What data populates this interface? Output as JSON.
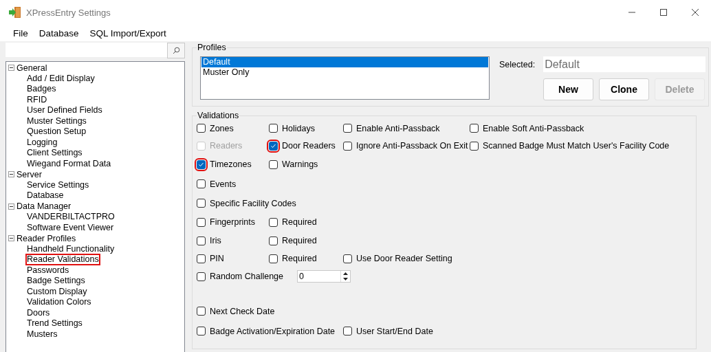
{
  "window": {
    "title": "XPressEntry Settings"
  },
  "menu": [
    "File",
    "Database",
    "SQL Import/Export"
  ],
  "tree": [
    {
      "label": "General",
      "expanded": true,
      "children": [
        {
          "label": "Add / Edit Display",
          "highlighted": false
        },
        {
          "label": "Badges",
          "highlighted": false
        },
        {
          "label": "RFID",
          "highlighted": false
        },
        {
          "label": "User Defined Fields",
          "highlighted": false
        },
        {
          "label": "Muster Settings",
          "highlighted": false
        },
        {
          "label": "Question Setup",
          "highlighted": false
        },
        {
          "label": "Logging",
          "highlighted": false
        },
        {
          "label": "Client Settings",
          "highlighted": false
        },
        {
          "label": "Wiegand Format Data",
          "highlighted": false
        }
      ]
    },
    {
      "label": "Server",
      "expanded": true,
      "children": [
        {
          "label": "Service Settings",
          "highlighted": false
        },
        {
          "label": "Database",
          "highlighted": false
        }
      ]
    },
    {
      "label": "Data Manager",
      "expanded": true,
      "children": [
        {
          "label": "VANDERBILTACTPRO",
          "highlighted": false
        },
        {
          "label": "Software Event Viewer",
          "highlighted": false
        }
      ]
    },
    {
      "label": "Reader Profiles",
      "expanded": true,
      "children": [
        {
          "label": "Handheld Functionality",
          "highlighted": false
        },
        {
          "label": "Reader Validations",
          "highlighted": true
        },
        {
          "label": "Passwords",
          "highlighted": false
        },
        {
          "label": "Badge Settings",
          "highlighted": false
        },
        {
          "label": "Custom Display",
          "highlighted": false
        },
        {
          "label": "Validation Colors",
          "highlighted": false
        },
        {
          "label": "Doors",
          "highlighted": false
        },
        {
          "label": "Trend Settings",
          "highlighted": false
        },
        {
          "label": "Musters",
          "highlighted": false
        }
      ]
    }
  ],
  "profiles": {
    "title": "Profiles",
    "items": [
      {
        "label": "Default",
        "selected": true
      },
      {
        "label": "Muster Only",
        "selected": false
      }
    ],
    "selected_label": "Selected:",
    "selected_value": "Default",
    "buttons": [
      {
        "label": "New",
        "disabled": false
      },
      {
        "label": "Clone",
        "disabled": false
      },
      {
        "label": "Delete",
        "disabled": true
      }
    ]
  },
  "validations": {
    "title": "Validations",
    "rows": [
      [
        {
          "kind": "checkbox",
          "label": "Zones",
          "checked": false,
          "disabled": false,
          "highlighted": false
        },
        {
          "kind": "checkbox",
          "label": "Holidays",
          "checked": false,
          "disabled": false,
          "highlighted": false
        },
        {
          "kind": "checkbox",
          "label": "Enable Anti-Passback",
          "checked": false,
          "disabled": false,
          "highlighted": false
        },
        {
          "kind": "checkbox",
          "label": "Enable Soft Anti-Passback",
          "checked": false,
          "disabled": false,
          "highlighted": false
        }
      ],
      [
        {
          "kind": "checkbox",
          "label": "Readers",
          "checked": false,
          "disabled": true,
          "highlighted": false
        },
        {
          "kind": "checkbox",
          "label": "Door Readers",
          "checked": true,
          "disabled": false,
          "highlighted": true
        },
        {
          "kind": "checkbox",
          "label": "Ignore Anti-Passback On Exit",
          "checked": false,
          "disabled": false,
          "highlighted": false
        },
        {
          "kind": "checkbox",
          "label": "Scanned Badge Must Match User's Facility Code",
          "checked": false,
          "disabled": false,
          "highlighted": false
        }
      ],
      [
        {
          "kind": "checkbox",
          "label": "Timezones",
          "checked": true,
          "disabled": false,
          "highlighted": true
        },
        {
          "kind": "checkbox",
          "label": "Warnings",
          "checked": false,
          "disabled": false,
          "highlighted": false
        }
      ],
      [
        {
          "kind": "checkbox",
          "label": "Events",
          "checked": false,
          "disabled": false,
          "highlighted": false
        }
      ],
      [
        {
          "kind": "checkbox",
          "label": "Specific Facility Codes",
          "checked": false,
          "disabled": false,
          "highlighted": false
        }
      ],
      [
        {
          "kind": "checkbox",
          "label": "Fingerprints",
          "checked": false,
          "disabled": false,
          "highlighted": false
        },
        {
          "kind": "checkbox",
          "label": "Required",
          "checked": false,
          "disabled": false,
          "highlighted": false
        }
      ],
      [
        {
          "kind": "checkbox",
          "label": "Iris",
          "checked": false,
          "disabled": false,
          "highlighted": false
        },
        {
          "kind": "checkbox",
          "label": "Required",
          "checked": false,
          "disabled": false,
          "highlighted": false
        }
      ],
      [
        {
          "kind": "checkbox",
          "label": "PIN",
          "checked": false,
          "disabled": false,
          "highlighted": false
        },
        {
          "kind": "checkbox",
          "label": "Required",
          "checked": false,
          "disabled": false,
          "highlighted": false
        },
        {
          "kind": "checkbox",
          "label": "Use Door Reader Setting",
          "checked": false,
          "disabled": false,
          "highlighted": false
        }
      ],
      [
        {
          "kind": "checkbox",
          "label": "Random Challenge",
          "checked": false,
          "disabled": false,
          "highlighted": false
        },
        {
          "kind": "spinner",
          "value": "0"
        }
      ],
      [
        {
          "kind": "checkbox",
          "label": "Next Check Date",
          "checked": false,
          "disabled": false,
          "highlighted": false
        }
      ],
      [
        {
          "kind": "checkbox",
          "label": "Badge Activation/Expiration Date",
          "checked": false,
          "disabled": false,
          "highlighted": false
        },
        "",
        {
          "kind": "checkbox",
          "label": "User Start/End Date",
          "checked": false,
          "disabled": false,
          "highlighted": false
        }
      ]
    ]
  }
}
